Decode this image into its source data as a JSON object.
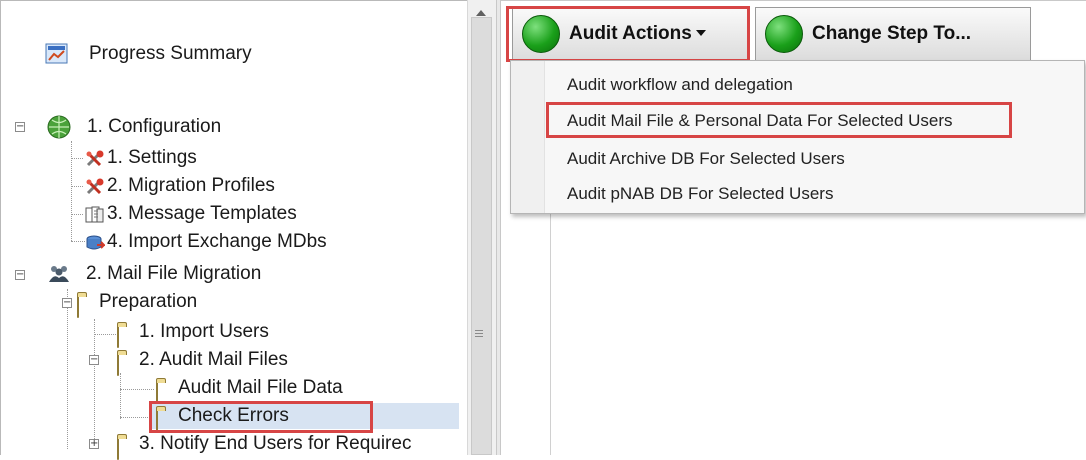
{
  "tree": {
    "progress_summary": "Progress Summary",
    "configuration": "1. Configuration",
    "settings": "1. Settings",
    "migration_profiles": "2. Migration Profiles",
    "message_templates": "3. Message Templates",
    "import_exchange_mdbs": "4. Import Exchange MDbs",
    "mail_file_migration": "2. Mail File Migration",
    "preparation": "Preparation",
    "import_users": "1. Import Users",
    "audit_mail_files": "2. Audit Mail Files",
    "audit_mail_file_data": "Audit Mail File Data",
    "check_errors": "Check Errors",
    "notify_end_users": "3. Notify End Users for Requirec",
    "expander_minus": "−",
    "expander_plus": "+"
  },
  "toolbar": {
    "audit_actions_label": "Audit Actions",
    "change_step_label": "Change Step To..."
  },
  "menu": {
    "items": [
      "Audit workflow and delegation",
      "Audit Mail File & Personal Data For Selected Users",
      "Audit Archive DB For Selected Users",
      "Audit pNAB DB For Selected Users"
    ]
  },
  "colors": {
    "highlight_red": "#d74545",
    "selection_blue": "#d7e3f2",
    "status_green": "#1aa01a"
  }
}
